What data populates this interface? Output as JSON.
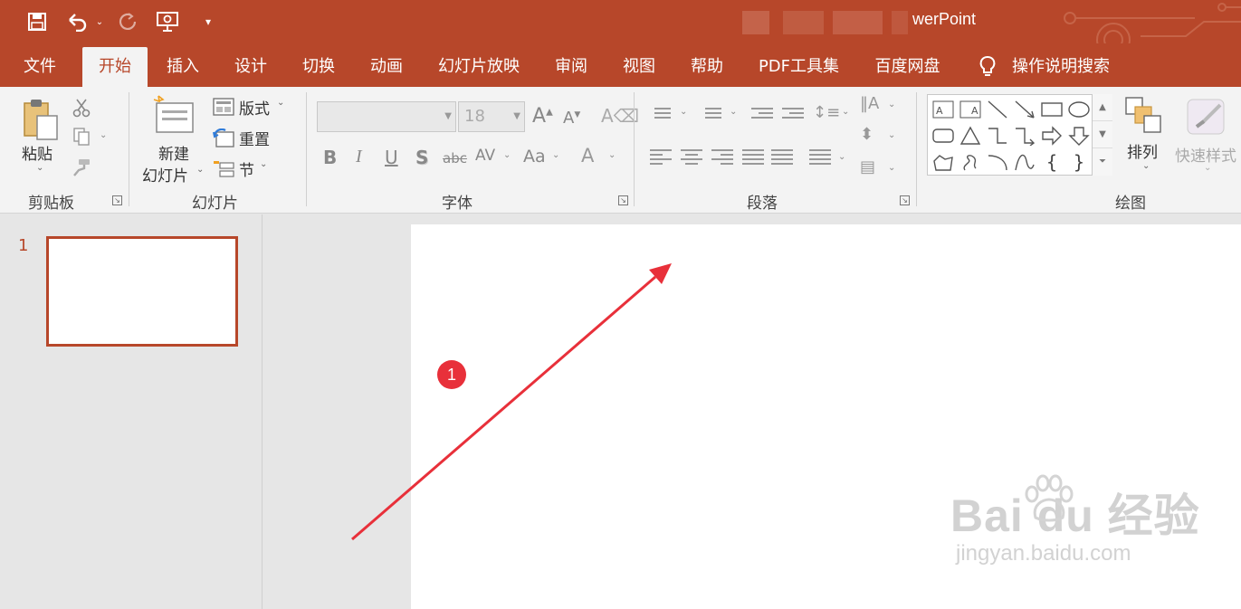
{
  "titlebar": {
    "title": "werPoint",
    "qat": {
      "save_icon": "save-icon",
      "undo_icon": "undo-icon",
      "redo_icon": "redo-icon",
      "present_icon": "start-presentation-icon",
      "customize_icon": "customize-qat-icon"
    }
  },
  "tabs": [
    {
      "label": "文件"
    },
    {
      "label": "开始"
    },
    {
      "label": "插入"
    },
    {
      "label": "设计"
    },
    {
      "label": "切换"
    },
    {
      "label": "动画"
    },
    {
      "label": "幻灯片放映"
    },
    {
      "label": "审阅"
    },
    {
      "label": "视图"
    },
    {
      "label": "帮助"
    },
    {
      "label": "PDF工具集"
    },
    {
      "label": "百度网盘"
    }
  ],
  "active_tab": "开始",
  "tell_me": {
    "label": "操作说明搜索",
    "icon": "lightbulb-icon"
  },
  "ribbon": {
    "clipboard": {
      "label": "剪贴板",
      "paste_label": "粘贴"
    },
    "slides": {
      "label": "幻灯片",
      "new_slide_line1": "新建",
      "new_slide_line2": "幻灯片",
      "layout_label": "版式",
      "reset_label": "重置",
      "section_label": "节"
    },
    "font": {
      "label": "字体",
      "font_name_value": "",
      "font_size_value": "18",
      "bold": "B",
      "italic": "I",
      "underline": "U",
      "shadow": "S",
      "strike": "abc",
      "spacing": "AV",
      "case": "Aa",
      "color": "A"
    },
    "paragraph": {
      "label": "段落"
    },
    "drawing": {
      "label": "绘图",
      "arrange_label": "排列",
      "quick_styles_label": "快速样式"
    }
  },
  "thumbnails": [
    {
      "number": "1"
    }
  ],
  "annotation": {
    "badge_number": "1",
    "color": "#e8303a"
  },
  "watermark": {
    "main": "Bai du 经验",
    "sub": "jingyan.baidu.com"
  },
  "colors": {
    "accent": "#b7472a",
    "ribbon_bg": "#f3f3f3",
    "workspace_bg": "#e6e6e6"
  }
}
